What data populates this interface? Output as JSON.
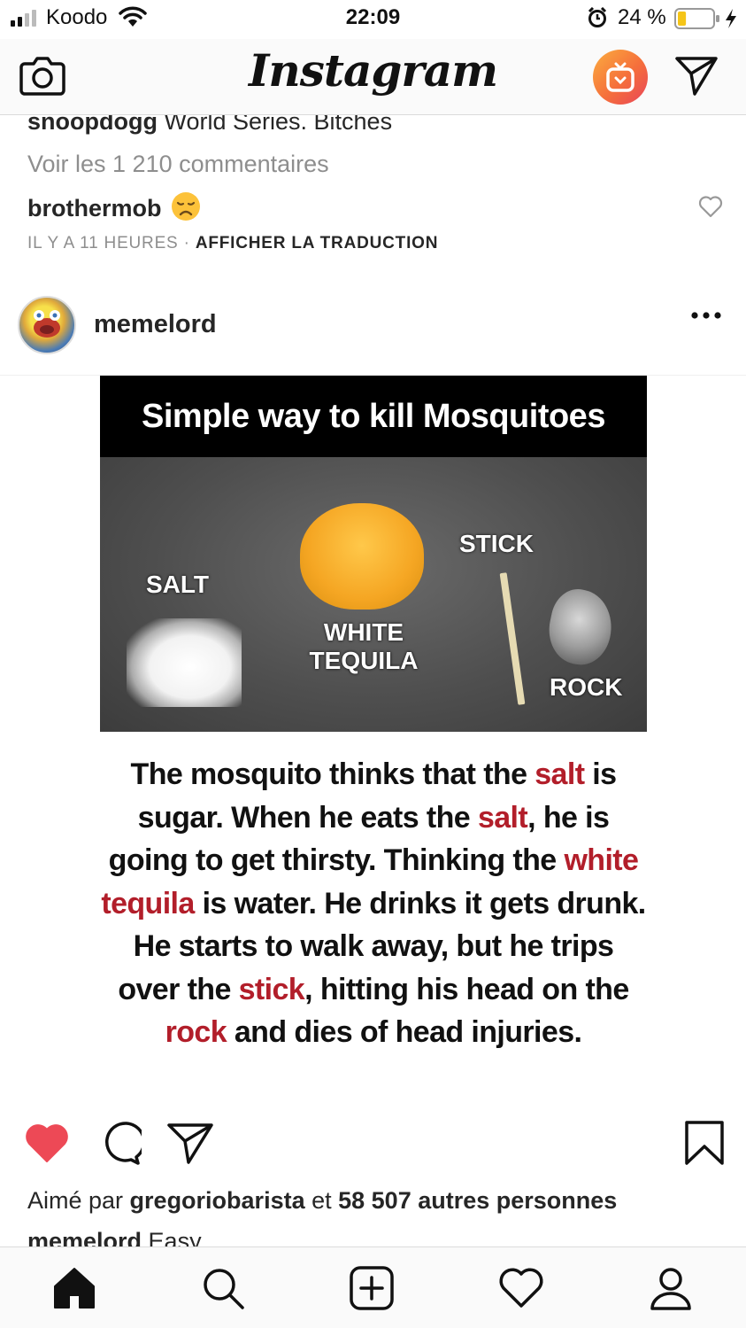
{
  "status_bar": {
    "carrier": "Koodo",
    "time": "22:09",
    "battery_percent": "24 %",
    "battery_level": 0.24
  },
  "header": {
    "logo_text": "Instagram",
    "camera_icon": "camera-icon",
    "igtv_icon": "igtv-icon",
    "direct_icon": "paper-plane-icon"
  },
  "previous_post": {
    "caption_user": "snoopdogg",
    "caption_text": " World Series. Bitches",
    "view_comments": "Voir les 1 210 commentaires",
    "comment_user": "brothermob",
    "comment_emoji": "disappointed-face-emoji",
    "time_ago": "IL Y A 11 HEURES",
    "separator": " · ",
    "translate": "AFFICHER LA TRADUCTION"
  },
  "post": {
    "username": "memelord",
    "more_icon": "more-options-icon",
    "meme": {
      "title": "Simple way to kill Mosquitoes",
      "labels": {
        "salt": "SALT",
        "tequila_line1": "WHITE",
        "tequila_line2": "TEQUILA",
        "stick": "STICK",
        "rock": "ROCK"
      },
      "story": {
        "s1": "The mosquito thinks that the ",
        "r1": "salt",
        "s2": " is sugar. When he eats the ",
        "r2": "salt",
        "s3": ", he is going to get thirsty. Thinking the ",
        "r3": "white tequila",
        "s4": " is water. He drinks it gets drunk. He starts to walk away, but he trips over the ",
        "r4": "stick",
        "s5": ", hitting his head on the ",
        "r5": "rock",
        "s6": " and dies of head injuries."
      }
    },
    "liked": true,
    "likes_prefix": "Aimé par ",
    "likes_user": "gregoriobarista",
    "likes_middle": " et ",
    "likes_count": "58 507 autres personnes",
    "caption_user": "memelord",
    "caption_text": " Easy"
  },
  "colors": {
    "like_red": "#ed4956",
    "meme_red": "#b21e2a",
    "muted_text": "#8e8e8e"
  },
  "tab_bar": {
    "items": [
      "home-icon",
      "search-icon",
      "new-post-icon",
      "activity-heart-icon",
      "profile-icon"
    ]
  }
}
